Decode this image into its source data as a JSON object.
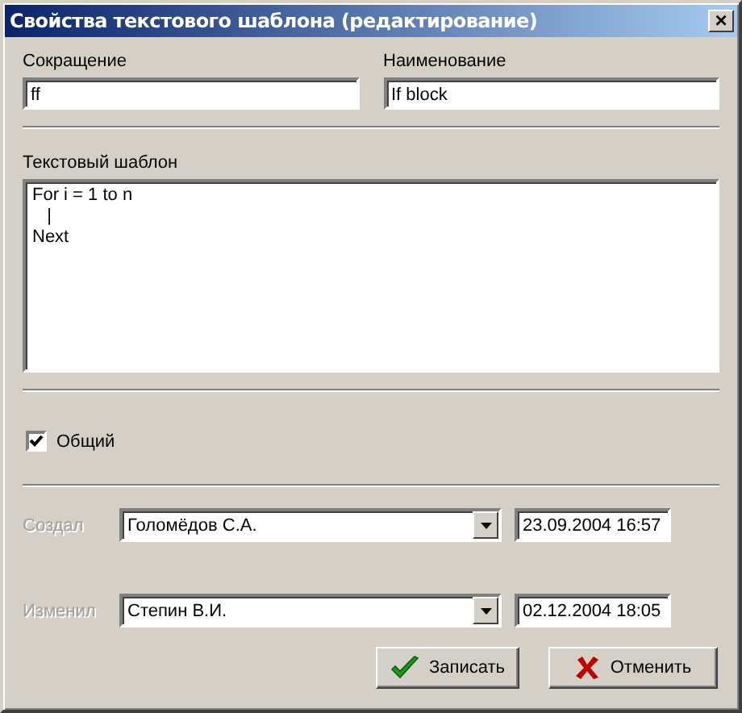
{
  "window": {
    "title": "Свойства текстового шаблона (редактирование)",
    "close": "×"
  },
  "fields": [
    {
      "label": "Сокращение",
      "value": "ff"
    },
    {
      "label": "Наименование",
      "value": "If block"
    }
  ],
  "template": {
    "label": "Текстовый шаблон",
    "value": "For i = 1 to n\n   |\nNext"
  },
  "common": {
    "label": "Общий",
    "checked": true
  },
  "history": [
    {
      "label": "Создал",
      "disabled": true,
      "user": "Голомёдов С.А.",
      "date": "23.09.2004 16:57"
    },
    {
      "label": "Изменил",
      "disabled": true,
      "user": "Степин В.И.",
      "date": "02.12.2004 18:05"
    }
  ],
  "buttons": [
    {
      "kind": "ok",
      "label": "Записать"
    },
    {
      "kind": "cancel",
      "label": "Отменить"
    }
  ]
}
